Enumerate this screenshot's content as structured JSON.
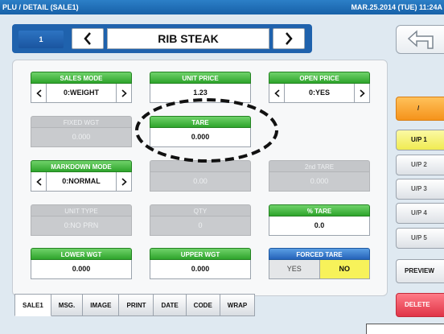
{
  "titlebar": {
    "title": "PLU / DETAIL (SALE1)",
    "datetime": "MAR.25.2014 (TUE) 11:24A"
  },
  "nav": {
    "plu_number": "1",
    "item_name": "RIB STEAK"
  },
  "fields": {
    "sales_mode": {
      "label": "SALES MODE",
      "value": "0:WEIGHT"
    },
    "unit_price": {
      "label": "UNIT PRICE",
      "value": "1.23"
    },
    "open_price": {
      "label": "OPEN PRICE",
      "value": "0:YES"
    },
    "fixed_wgt": {
      "label": "FIXED WGT",
      "value": "0.000"
    },
    "tare": {
      "label": "TARE",
      "value": "0.000"
    },
    "markdown_mode": {
      "label": "MARKDOWN MODE",
      "value": "0:NORMAL"
    },
    "hidden_field": {
      "label": "",
      "value": "0.00"
    },
    "second_tare": {
      "label": "2nd TARE",
      "value": "0.000"
    },
    "unit_type": {
      "label": "UNIT TYPE",
      "value": "0:NO PRN"
    },
    "qty": {
      "label": "QTY",
      "value": "0"
    },
    "percent_tare": {
      "label": "% TARE",
      "value": "0.0"
    },
    "lower_wgt": {
      "label": "LOWER WGT",
      "value": "0.000"
    },
    "upper_wgt": {
      "label": "UPPER WGT",
      "value": "0.000"
    },
    "forced_tare": {
      "label": "FORCED TARE",
      "yes": "YES",
      "no": "NO",
      "selected": "NO"
    }
  },
  "tabs": [
    "SALE1",
    "MSG.",
    "IMAGE",
    "PRINT",
    "DATE",
    "CODE",
    "WRAP"
  ],
  "active_tab": "SALE1",
  "side": {
    "slash": "/",
    "up1": "U/P 1",
    "up2": "U/P 2",
    "up3": "U/P 3",
    "up4": "U/P 4",
    "up5": "U/P 5",
    "preview": "PREVIEW",
    "delete": "DELETE"
  },
  "colors": {
    "title_bar": "#1c68b3",
    "label_green": "#3fb03b",
    "selected_yellow": "#f3ef5a",
    "delete_red": "#e6394b",
    "orange": "#f7a02a"
  }
}
